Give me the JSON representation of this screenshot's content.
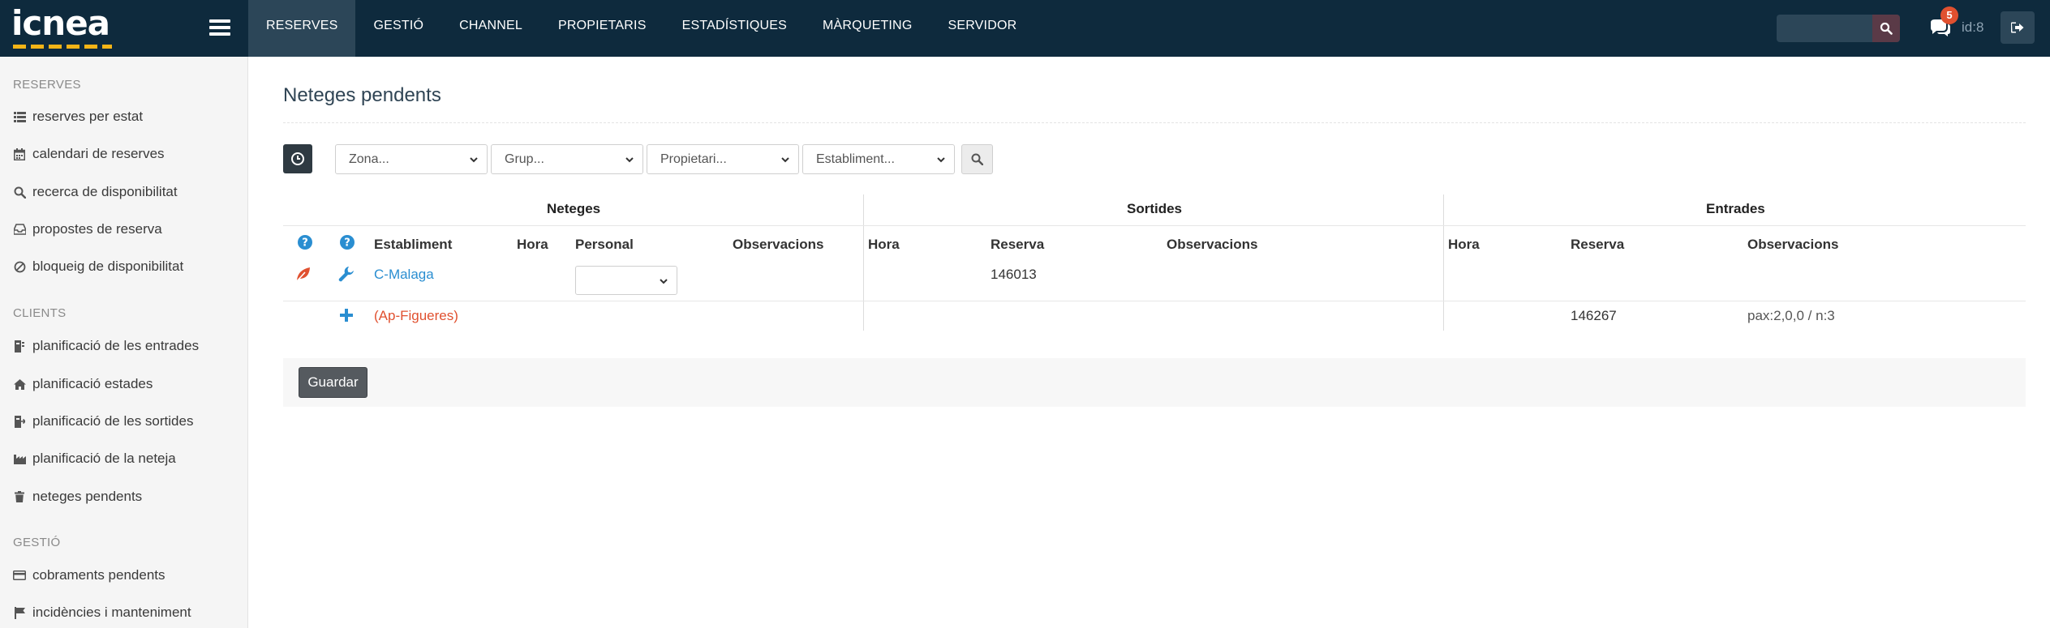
{
  "logo": {
    "text": "icnea"
  },
  "nav": {
    "items": [
      "RESERVES",
      "GESTIÓ",
      "CHANNEL",
      "PROPIETARIS",
      "ESTADÍSTIQUES",
      "MÀRQUETING",
      "SERVIDOR"
    ],
    "active": "RESERVES"
  },
  "header": {
    "search_placeholder": "",
    "notifications_count": "5",
    "user_id": "id:8"
  },
  "sidebar": {
    "sections": [
      {
        "title": "RESERVES",
        "items": [
          {
            "label": "reserves per estat",
            "icon": "list-icon"
          },
          {
            "label": "calendari de reserves",
            "icon": "calendar-icon"
          },
          {
            "label": "recerca de disponibilitat",
            "icon": "search-icon"
          },
          {
            "label": "propostes de reserva",
            "icon": "inbox-icon"
          },
          {
            "label": "bloqueig de disponibilitat",
            "icon": "ban-icon"
          }
        ]
      },
      {
        "title": "CLIENTS",
        "items": [
          {
            "label": "planificació de les entrades",
            "icon": "door-in-icon"
          },
          {
            "label": "planificació estades",
            "icon": "home-icon"
          },
          {
            "label": "planificació de les sortides",
            "icon": "door-out-icon"
          },
          {
            "label": "planificació de la neteja",
            "icon": "industry-icon"
          },
          {
            "label": "neteges pendents",
            "icon": "trash-icon"
          }
        ]
      },
      {
        "title": "GESTIÓ",
        "items": [
          {
            "label": "cobraments pendents",
            "icon": "credit-card-icon"
          },
          {
            "label": "incidències i manteniment",
            "icon": "flag-icon"
          }
        ]
      }
    ]
  },
  "main": {
    "title": "Neteges pendents",
    "filters": {
      "zona": "Zona...",
      "grup": "Grup...",
      "propietari": "Propietari...",
      "establiment": "Establiment..."
    },
    "groups": {
      "neteges": "Neteges",
      "sortides": "Sortides",
      "entrades": "Entrades"
    },
    "columns": {
      "establiment": "Establiment",
      "hora": "Hora",
      "personal": "Personal",
      "observacions": "Observacions",
      "reserva": "Reserva"
    },
    "rows": [
      {
        "establiment": "C-Malaga",
        "sortida_reserva": "146013",
        "entrada_reserva": "",
        "entrada_obs": ""
      },
      {
        "establiment": "(Ap-Figueres)",
        "sortida_reserva": "",
        "entrada_reserva": "146267",
        "entrada_obs": "pax:2,0,0 / n:3"
      }
    ],
    "save_label": "Guardar"
  },
  "colors": {
    "topbar": "#0e2a3d",
    "nav_active": "#2c4658",
    "logo_accent": "#f3b417",
    "link_blue": "#2a8ed1",
    "link_red": "#e0502f",
    "badge": "#e0502f"
  }
}
